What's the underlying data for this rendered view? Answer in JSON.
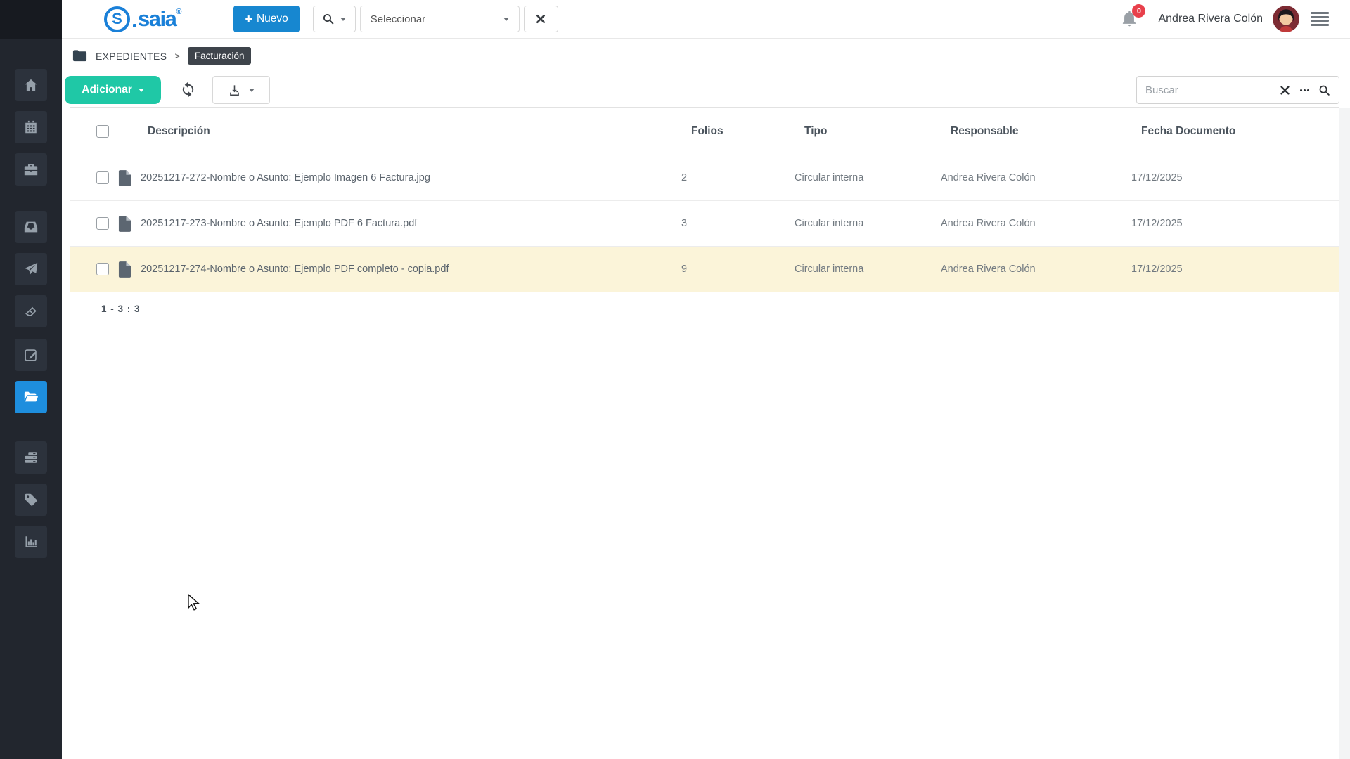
{
  "app": {
    "logo_s": "S",
    "logo_text": "saia",
    "logo_reg": "®"
  },
  "topbar": {
    "nuevo": {
      "plus": "+",
      "label": "Nuevo"
    },
    "entity_select": {
      "value": "Seleccionar"
    },
    "notifications": {
      "count": "0"
    },
    "user": {
      "name": "Andrea Rivera Colón"
    }
  },
  "breadcrumb": {
    "root": "EXPEDIENTES",
    "separator": ">",
    "current": "Facturación"
  },
  "toolbar": {
    "adicionar_label": "Adicionar",
    "search": {
      "placeholder": "Buscar"
    }
  },
  "table": {
    "headers": {
      "descripcion": "Descripción",
      "folios": "Folios",
      "tipo": "Tipo",
      "responsable": "Responsable",
      "fecha": "Fecha Documento"
    },
    "rows": [
      {
        "name": "20251217-272-Nombre o Asunto: Ejemplo Imagen 6 Factura.jpg",
        "folios": "2",
        "tipo": "Circular interna",
        "responsable": "Andrea Rivera Colón",
        "fecha": "17/12/2025",
        "highlighted": false
      },
      {
        "name": "20251217-273-Nombre o Asunto: Ejemplo PDF 6 Factura.pdf",
        "folios": "3",
        "tipo": "Circular interna",
        "responsable": "Andrea Rivera Colón",
        "fecha": "17/12/2025",
        "highlighted": false
      },
      {
        "name": "20251217-274-Nombre o Asunto: Ejemplo PDF completo - copia.pdf",
        "folios": "9",
        "tipo": "Circular interna",
        "responsable": "Andrea Rivera Colón",
        "fecha": "17/12/2025",
        "highlighted": true
      }
    ],
    "pagination": "1 - 3 : 3"
  },
  "sidebar": {
    "items": [
      {
        "icon": "home",
        "active": false
      },
      {
        "icon": "calendar",
        "active": false
      },
      {
        "icon": "briefcase",
        "active": false
      },
      {
        "icon": "inbox",
        "active": false
      },
      {
        "icon": "paper-plane",
        "active": false
      },
      {
        "icon": "eraser",
        "active": false
      },
      {
        "icon": "edit",
        "active": false
      },
      {
        "icon": "folder-open",
        "active": true
      },
      {
        "icon": "server",
        "active": false
      },
      {
        "icon": "tag",
        "active": false
      },
      {
        "icon": "bar-chart",
        "active": false
      }
    ]
  },
  "icons": {
    "global_search": "magnifier",
    "select_caret": "caret-down",
    "clear_selection": "x-mark",
    "notifications": "bell",
    "user_menu": "list-menu",
    "adicionar_caret": "caret-down",
    "refresh": "sync-arrows",
    "export": "download",
    "export_caret": "caret-down",
    "search_clear": "x-mark",
    "search_more": "ellipsis",
    "search_submit": "magnifier",
    "breadcrumb_folder": "folder",
    "row_file": "document"
  },
  "colors": {
    "primary_blue": "#1787d0",
    "logo_blue": "#1a80d8",
    "accent_teal": "#1fc8a6",
    "sidebar_bg": "#22262e",
    "sidebar_active_blue": "#1e8ede",
    "notification_red": "#e8404b",
    "row_highlight": "#fbf4d9",
    "badge_dark": "#3e444b"
  }
}
